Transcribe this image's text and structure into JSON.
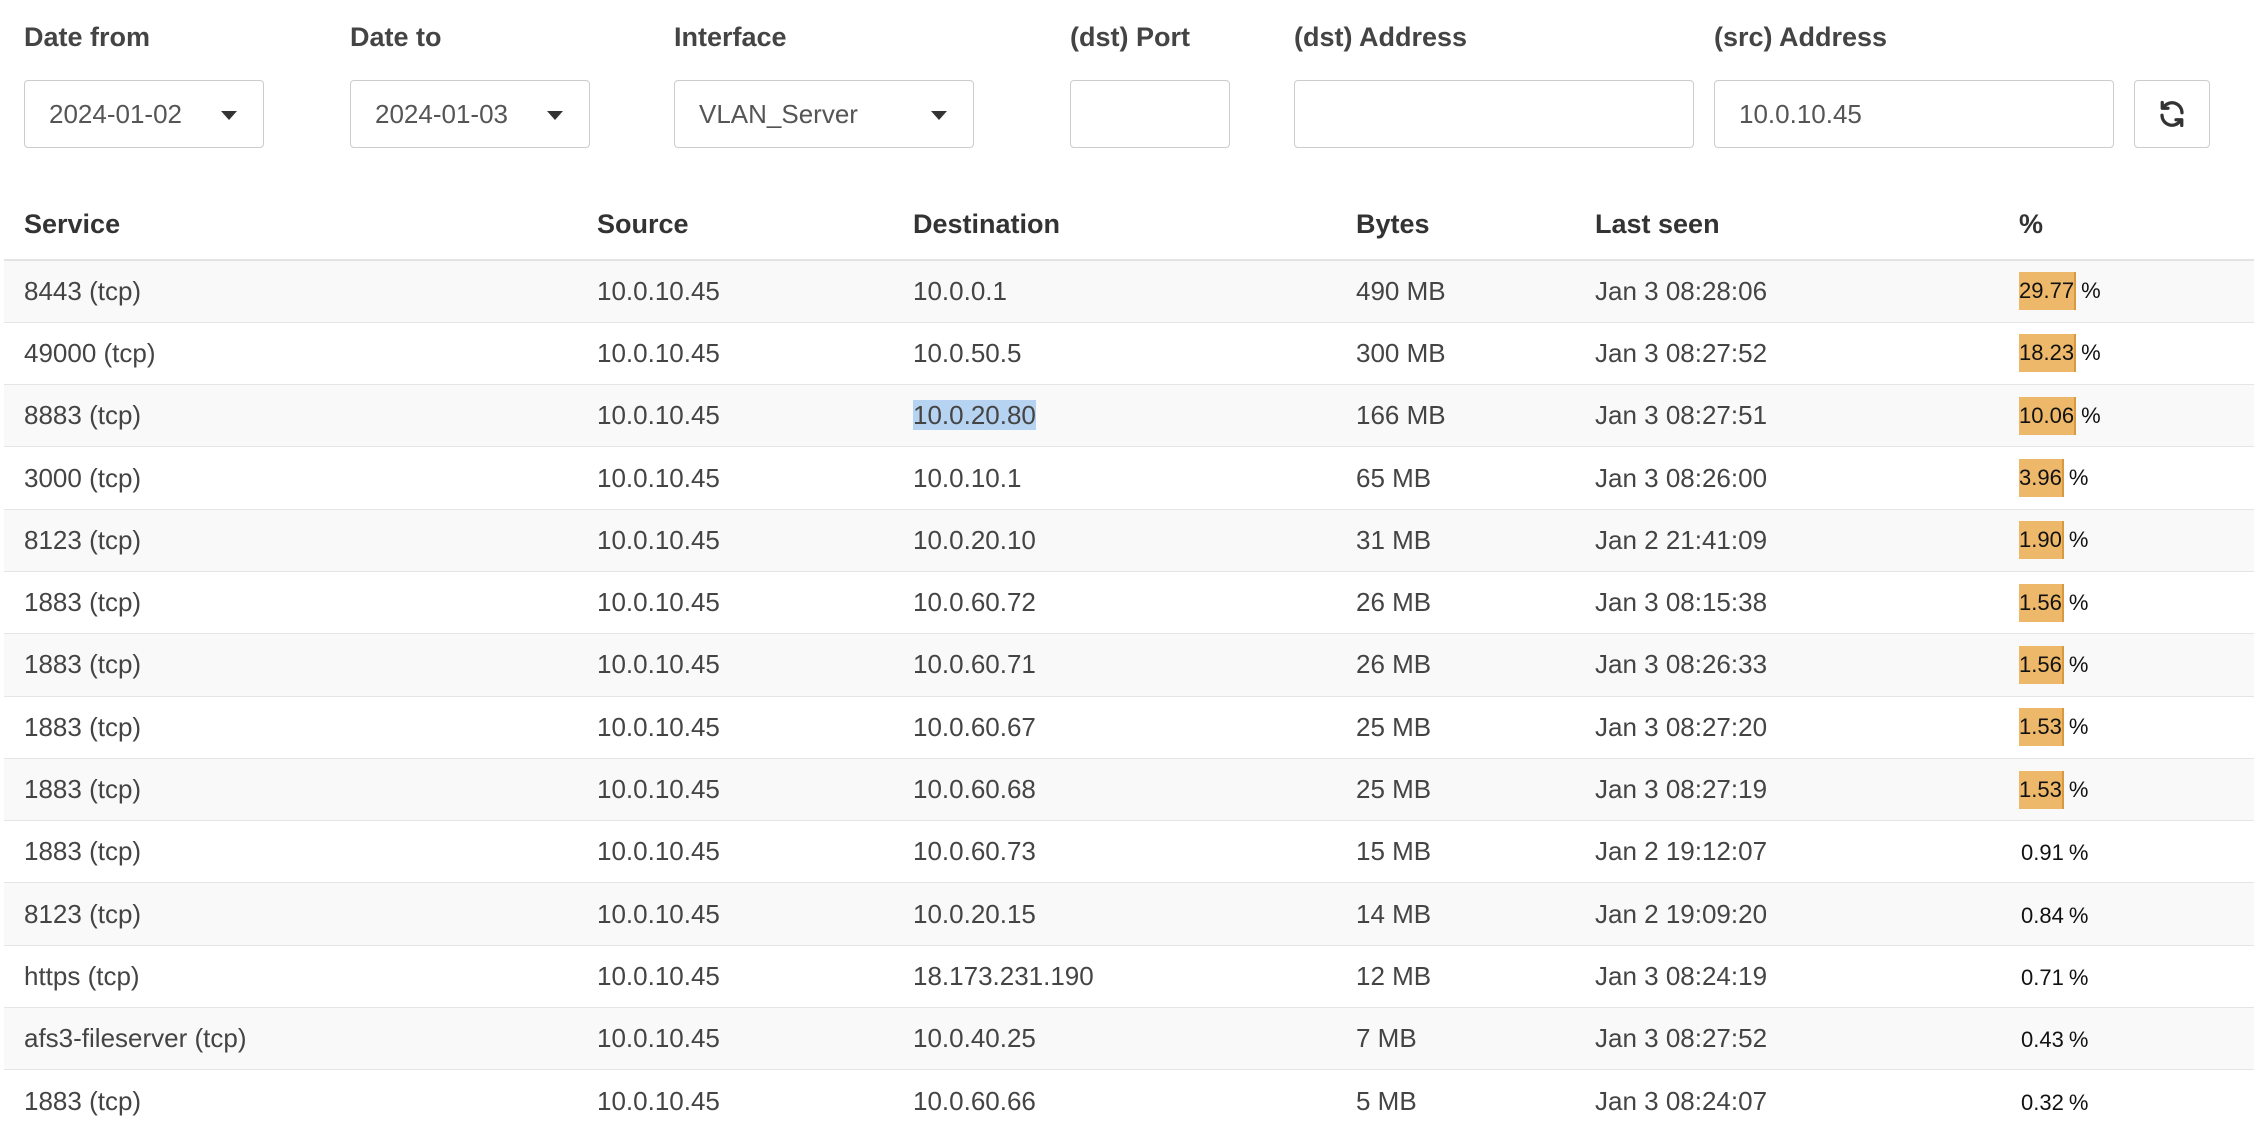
{
  "filters": {
    "date_from": {
      "label": "Date from",
      "value": "2024-01-02"
    },
    "date_to": {
      "label": "Date to",
      "value": "2024-01-03"
    },
    "interface": {
      "label": "Interface",
      "value": "VLAN_Server"
    },
    "dst_port": {
      "label": "(dst) Port",
      "value": ""
    },
    "dst_address": {
      "label": "(dst) Address",
      "value": ""
    },
    "src_address": {
      "label": "(src) Address",
      "value": "10.0.10.45"
    },
    "refresh_icon": "refresh-icon"
  },
  "table": {
    "headers": [
      "Service",
      "Source",
      "Destination",
      "Bytes",
      "Last seen",
      "%"
    ],
    "rows": [
      {
        "service": "8443 (tcp)",
        "source": "10.0.10.45",
        "destination": "10.0.0.1",
        "bytes": "490 MB",
        "last_seen": "Jan 3 08:28:06",
        "pct": "29.77",
        "pct_unit": "%"
      },
      {
        "service": "49000 (tcp)",
        "source": "10.0.10.45",
        "destination": "10.0.50.5",
        "bytes": "300 MB",
        "last_seen": "Jan 3 08:27:52",
        "pct": "18.23",
        "pct_unit": "%"
      },
      {
        "service": "8883 (tcp)",
        "source": "10.0.10.45",
        "destination": "10.0.20.80",
        "bytes": "166 MB",
        "last_seen": "Jan 3 08:27:51",
        "pct": "10.06",
        "pct_unit": "%",
        "selected": true
      },
      {
        "service": "3000 (tcp)",
        "source": "10.0.10.45",
        "destination": "10.0.10.1",
        "bytes": "65 MB",
        "last_seen": "Jan 3 08:26:00",
        "pct": "3.96",
        "pct_unit": "%"
      },
      {
        "service": "8123 (tcp)",
        "source": "10.0.10.45",
        "destination": "10.0.20.10",
        "bytes": "31 MB",
        "last_seen": "Jan 2 21:41:09",
        "pct": "1.90",
        "pct_unit": "%"
      },
      {
        "service": "1883 (tcp)",
        "source": "10.0.10.45",
        "destination": "10.0.60.72",
        "bytes": "26 MB",
        "last_seen": "Jan 3 08:15:38",
        "pct": "1.56",
        "pct_unit": "%"
      },
      {
        "service": "1883 (tcp)",
        "source": "10.0.10.45",
        "destination": "10.0.60.71",
        "bytes": "26 MB",
        "last_seen": "Jan 3 08:26:33",
        "pct": "1.56",
        "pct_unit": "%"
      },
      {
        "service": "1883 (tcp)",
        "source": "10.0.10.45",
        "destination": "10.0.60.67",
        "bytes": "25 MB",
        "last_seen": "Jan 3 08:27:20",
        "pct": "1.53",
        "pct_unit": "%"
      },
      {
        "service": "1883 (tcp)",
        "source": "10.0.10.45",
        "destination": "10.0.60.68",
        "bytes": "25 MB",
        "last_seen": "Jan 3 08:27:19",
        "pct": "1.53",
        "pct_unit": "%"
      },
      {
        "service": "1883 (tcp)",
        "source": "10.0.10.45",
        "destination": "10.0.60.73",
        "bytes": "15 MB",
        "last_seen": "Jan 2 19:12:07",
        "pct": "0.91",
        "pct_unit": "%"
      },
      {
        "service": "8123 (tcp)",
        "source": "10.0.10.45",
        "destination": "10.0.20.15",
        "bytes": "14 MB",
        "last_seen": "Jan 2 19:09:20",
        "pct": "0.84",
        "pct_unit": "%"
      },
      {
        "service": "https (tcp)",
        "source": "10.0.10.45",
        "destination": "18.173.231.190",
        "bytes": "12 MB",
        "last_seen": "Jan 3 08:24:19",
        "pct": "0.71",
        "pct_unit": "%"
      },
      {
        "service": "afs3-fileserver (tcp)",
        "source": "10.0.10.45",
        "destination": "10.0.40.25",
        "bytes": "7 MB",
        "last_seen": "Jan 3 08:27:52",
        "pct": "0.43",
        "pct_unit": "%"
      },
      {
        "service": "1883 (tcp)",
        "source": "10.0.10.45",
        "destination": "10.0.60.66",
        "bytes": "5 MB",
        "last_seen": "Jan 3 08:24:07",
        "pct": "0.32",
        "pct_unit": "%"
      }
    ]
  },
  "colors": {
    "bar_fill": "#edb869",
    "selection": "#b7d3f2"
  }
}
